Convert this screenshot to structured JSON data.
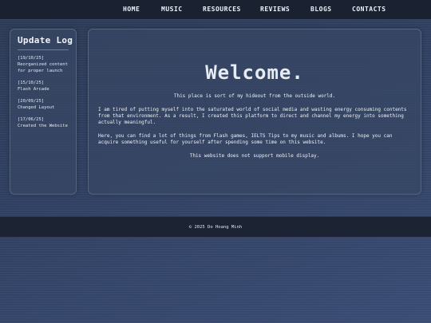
{
  "nav": {
    "items": [
      {
        "label": "HOME"
      },
      {
        "label": "MUSIC"
      },
      {
        "label": "RESOURCES"
      },
      {
        "label": "REVIEWS"
      },
      {
        "label": "BLOGS"
      },
      {
        "label": "CONTACTS"
      }
    ]
  },
  "sidebar": {
    "title": "Update Log",
    "entries": [
      {
        "date": "[19/10/25]",
        "text": "Reorganized content for proper launch"
      },
      {
        "date": "[15/10/25]",
        "text": "Flash Arcade"
      },
      {
        "date": "[20/09/25]",
        "text": "Changed Layout"
      },
      {
        "date": "[17/06/25]",
        "text": "Created the Website"
      }
    ]
  },
  "main": {
    "title": "Welcome.",
    "paragraphs": [
      "This place is sort of my hideout from the outside world.",
      "I am tired of putting myself into the saturated world of social media and wasting energy consuming contents from that environment. As a result, I created this platform to direct and channel my energy into something actually meaningful.",
      "Here, you can find a lot of things from Flash games, IELTS Tips to my music and albums. I hope you can acquire something useful for yourself after spending some time on this website.",
      "This website does not support mobile display."
    ]
  },
  "footer": {
    "text": "© 2025 Do Hoang Minh"
  }
}
